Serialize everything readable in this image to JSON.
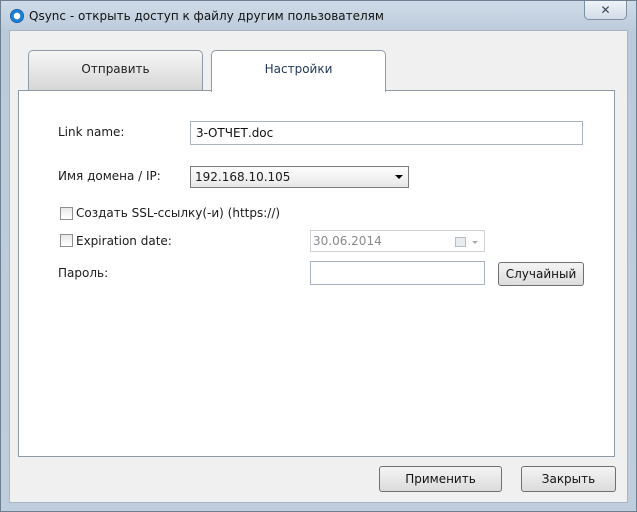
{
  "window": {
    "title": "Qsync - открыть доступ к файлу другим пользователям",
    "close_label": "✕"
  },
  "tabs": [
    {
      "label": "Отправить",
      "active": false
    },
    {
      "label": "Настройки",
      "active": true
    }
  ],
  "form": {
    "link_name": {
      "label": "Link name:",
      "value": "3-ОТЧЕТ.doc"
    },
    "domain": {
      "label": "Имя домена / IP:",
      "selected": "192.168.10.105"
    },
    "ssl": {
      "label": "Создать SSL-ссылку(-и) (https://)",
      "checked": false
    },
    "expiration": {
      "label": "Expiration date:",
      "checked": false,
      "value": "30.06.2014"
    },
    "password": {
      "label": "Пароль:",
      "value": "",
      "random_button": "Случайный"
    }
  },
  "footer": {
    "apply_label": "Применить",
    "close_label": "Закрыть"
  },
  "icons": {
    "app": "qsync-icon",
    "calendar": "calendar-icon"
  },
  "colors": {
    "titlebar": "#c9d6e4",
    "active_tab_text": "#23395b"
  }
}
